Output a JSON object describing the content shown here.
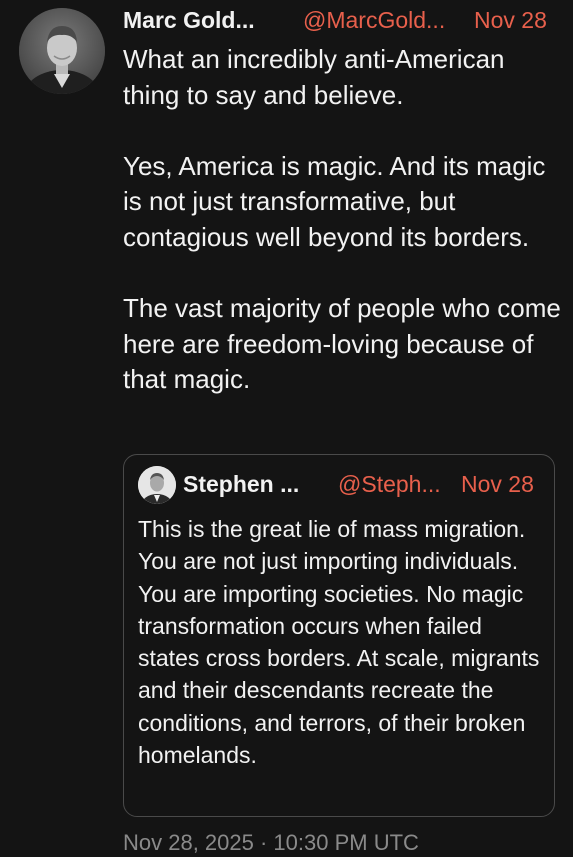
{
  "tweet": {
    "author_name": "Marc Gold...",
    "author_handle": "@MarcGold...",
    "date": "Nov 28",
    "text": "What an incredibly anti-American thing to say and believe.\n\nYes, America is magic. And its magic is not just transformative, but contagious well beyond its borders.\n\nThe vast majority of people who come here are freedom-loving because of that magic."
  },
  "quoted_tweet": {
    "author_name": "Stephen ...",
    "author_handle": "@Steph...",
    "date": "Nov 28",
    "text": "This is the great lie of mass migration. You are not just importing individuals. You are importing societies. No magic transformation occurs when failed states cross borders. At scale, migrants and their descendants recreate the conditions, and terrors, of their broken homelands."
  },
  "footer": {
    "timestamp": "Nov 28, 2025 · 10:30 PM UTC"
  },
  "colors": {
    "background": "#141414",
    "accent": "#e8604c",
    "text": "#f2f2f2",
    "border": "#4a4a4a"
  }
}
